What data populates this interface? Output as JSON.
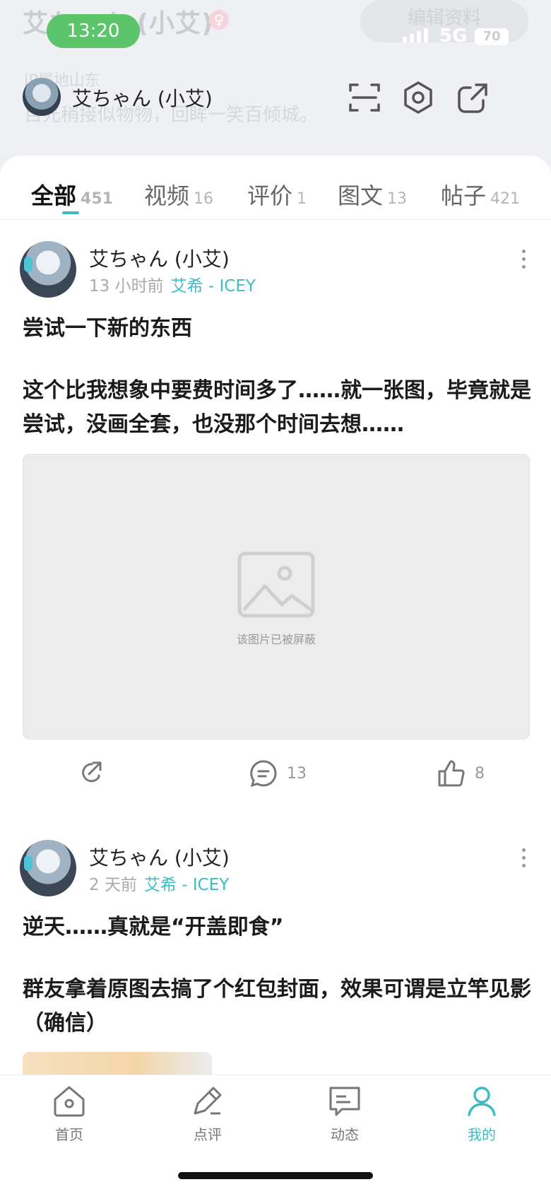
{
  "status_bar": {
    "time": "13:20",
    "network": "5G",
    "battery": "70"
  },
  "profile_header": {
    "name": "艾ちゃん (小艾)",
    "edit_button": "编辑资料",
    "location": "IP属地山东",
    "bio": "目光稍接似物物，回眸一笑百倾城。",
    "icons": [
      "scan-icon",
      "settings-icon",
      "share-icon"
    ]
  },
  "tabs": [
    {
      "label": "全部",
      "count": "451"
    },
    {
      "label": "视频",
      "count": "16"
    },
    {
      "label": "评价",
      "count": "1"
    },
    {
      "label": "图文",
      "count": "13"
    },
    {
      "label": "帖子",
      "count": "421"
    }
  ],
  "posts": [
    {
      "author": "艾ちゃん (小艾)",
      "time": "13 小时前",
      "topic": "艾希 - ICEY",
      "title": "尝试一下新的东西",
      "body": "这个比我想象中要费时间多了……就一张图，毕竟就是尝试，没画全套，也没那个时间去想……",
      "image_blocked_text": "该图片已被屏蔽",
      "comments": "13",
      "likes": "8"
    },
    {
      "author": "艾ちゃん (小艾)",
      "time": "2 天前",
      "topic": "艾希 - ICEY",
      "title": "逆天……真就是“开盖即食”",
      "body": "群友拿着原图去搞了个红包封面，效果可谓是立竿见影（确信）"
    }
  ],
  "bottom_nav": [
    {
      "label": "首页",
      "icon": "home-icon"
    },
    {
      "label": "点评",
      "icon": "pen-icon"
    },
    {
      "label": "动态",
      "icon": "message-icon"
    },
    {
      "label": "我的",
      "icon": "user-icon"
    }
  ],
  "colors": {
    "accent": "#3dbcc4",
    "time_pill": "#5cc46a"
  }
}
